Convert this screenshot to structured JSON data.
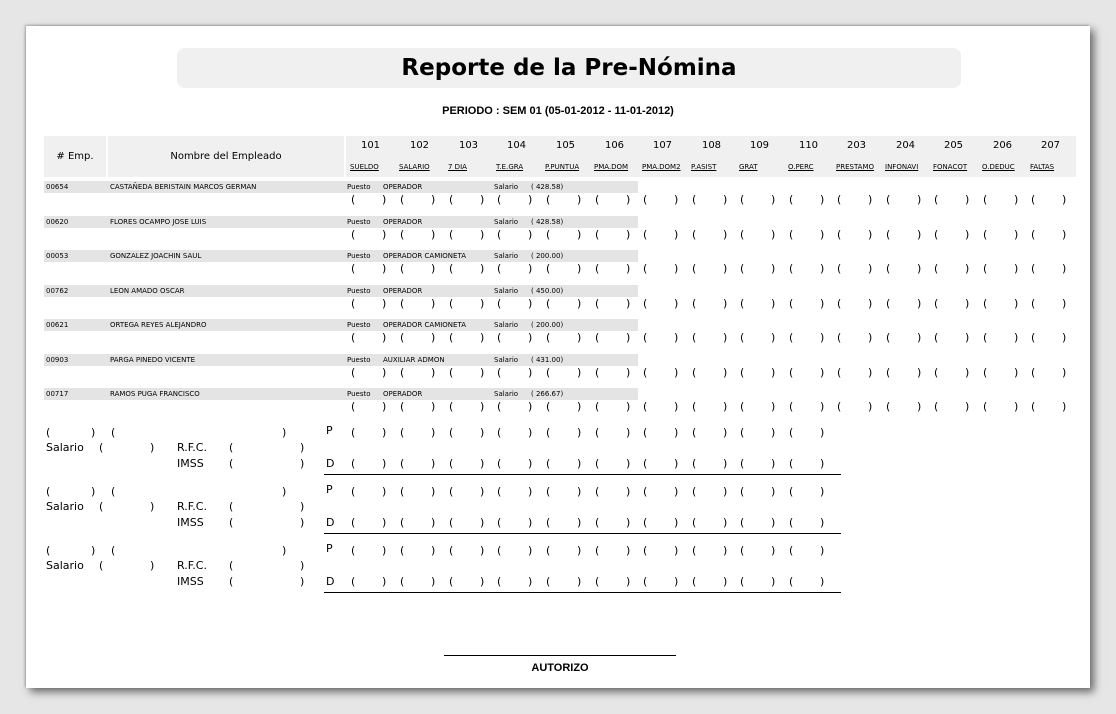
{
  "report": {
    "title": "Reporte de la Pre-Nómina",
    "period": "PERIODO : SEM 01 (05-01-2012 - 11-01-2012)"
  },
  "table_header": {
    "emp_num": "# Emp.",
    "emp_name": "Nombre del Empleado"
  },
  "columns": [
    {
      "code": "101",
      "label": "SUELDO"
    },
    {
      "code": "102",
      "label": "SALARIO"
    },
    {
      "code": "103",
      "label": "7 DIA"
    },
    {
      "code": "104",
      "label": "T.E.GRA"
    },
    {
      "code": "105",
      "label": "P.PUNTUA"
    },
    {
      "code": "106",
      "label": "PMA.DOM"
    },
    {
      "code": "107",
      "label": "PMA.DOM2"
    },
    {
      "code": "108",
      "label": "P.ASIST"
    },
    {
      "code": "109",
      "label": "GRAT"
    },
    {
      "code": "110",
      "label": "O.PERC"
    },
    {
      "code": "203",
      "label": "PRESTAMO"
    },
    {
      "code": "204",
      "label": "INFONAVI"
    },
    {
      "code": "205",
      "label": "FONACOT"
    },
    {
      "code": "206",
      "label": "O.DEDUC"
    },
    {
      "code": "207",
      "label": "FALTAS"
    }
  ],
  "labels": {
    "puesto": "Puesto",
    "salario": "Salario",
    "salario_summary": "Salario",
    "rfc": "R.F.C.",
    "imss": "IMSS",
    "p": "P",
    "d": "D",
    "paren_open": "(",
    "paren_close": ")",
    "autorizo": "AUTORIZO"
  },
  "employees": [
    {
      "num": "00654",
      "name": "CASTAÑEDA BERISTAIN MARCOS GERMAN",
      "puesto": "OPERADOR",
      "salario": "(   428.58)"
    },
    {
      "num": "00620",
      "name": "FLORES OCAMPO JOSE LUIS",
      "puesto": "OPERADOR",
      "salario": "(   428.58)"
    },
    {
      "num": "00053",
      "name": "GONZALEZ JOACHIN SAUL",
      "puesto": "OPERADOR CAMIONETA",
      "salario": "(   200.00)"
    },
    {
      "num": "00762",
      "name": "LEON AMADO OSCAR",
      "puesto": "OPERADOR",
      "salario": "(   450.00)"
    },
    {
      "num": "00621",
      "name": "ORTEGA REYES ALEJANDRO",
      "puesto": "OPERADOR CAMIONETA",
      "salario": "(   200.00)"
    },
    {
      "num": "00903",
      "name": "PARGA PINEDO VICENTE",
      "puesto": "AUXILIAR ADMON",
      "salario": "(   431.00)"
    },
    {
      "num": "00717",
      "name": "RAMOS PUGA FRANCISCO",
      "puesto": "OPERADOR",
      "salario": "(   266.67)"
    }
  ],
  "summary_blocks": 3
}
